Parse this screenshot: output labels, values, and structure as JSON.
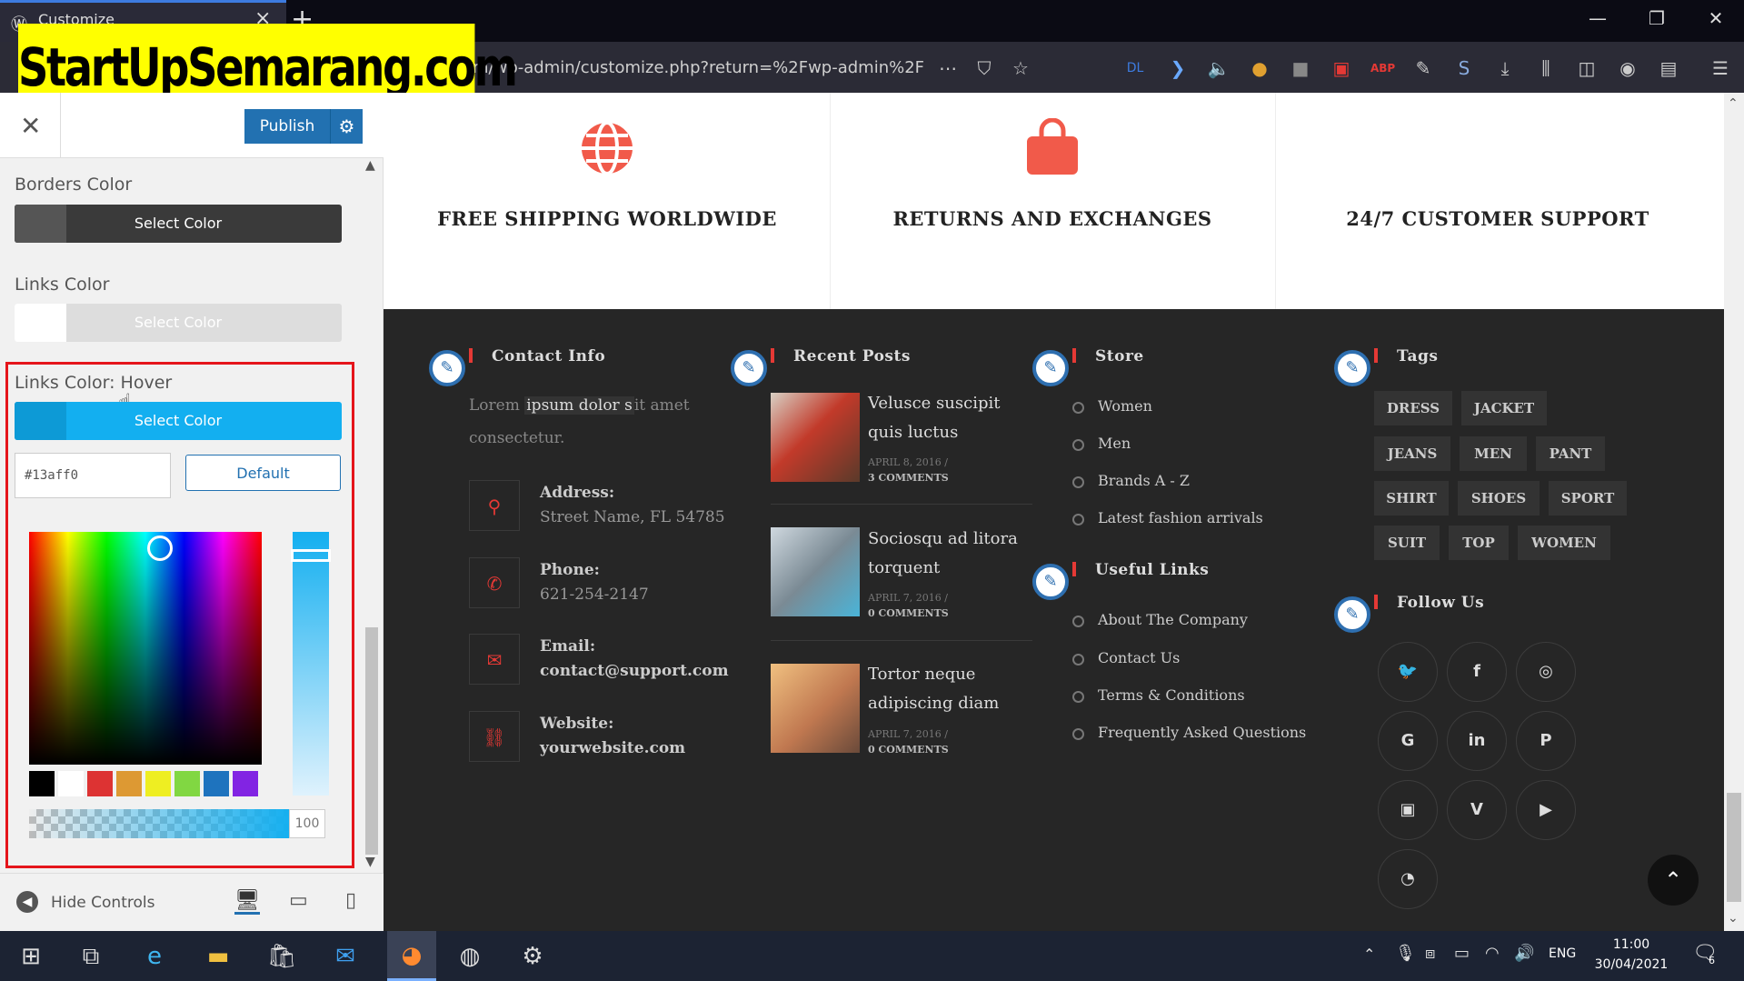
{
  "browser": {
    "tab_title": "Customize",
    "url": "m/wp-admin/customize.php?return=%2Fwp-admin%2F"
  },
  "brand": "StartUpSemarang.com",
  "customizer": {
    "publish_label": "Publish",
    "borders_color_label": "Borders Color",
    "links_color_label": "Links Color",
    "links_hover_label": "Links Color: Hover",
    "select_color_label": "Select Color",
    "hex_value": "#13aff0",
    "default_label": "Default",
    "alpha_value": "100",
    "hide_controls_label": "Hide Controls",
    "colors": {
      "borders": "#3a3a3a",
      "links": "#ffffff",
      "hover": "#13aff0",
      "accent_blue": "#2271b1"
    },
    "palette": [
      "#000000",
      "#ffffff",
      "#dd3333",
      "#dd9933",
      "#eeee22",
      "#81d742",
      "#1e73be",
      "#8224e3"
    ]
  },
  "features": [
    {
      "icon": "globe-icon",
      "title": "FREE SHIPPING WORLDWIDE"
    },
    {
      "icon": "shopping-bag-icon",
      "title": "RETURNS AND EXCHANGES"
    },
    {
      "icon": "support-icon",
      "title": "24/7 CUSTOMER SUPPORT"
    }
  ],
  "footer": {
    "contact": {
      "title": "Contact Info",
      "intro_1": "Lorem ",
      "intro_highlight": "ipsum dolor s",
      "intro_2": "it amet",
      "intro_3": "consectetur.",
      "address_label": "Address:",
      "address": "Street Name, FL 54785",
      "phone_label": "Phone:",
      "phone": "621-254-2147",
      "email_label": "Email:",
      "email": "contact@support.com",
      "website_label": "Website:",
      "website": "yourwebsite.com"
    },
    "posts": {
      "title": "Recent Posts",
      "items": [
        {
          "title1": "Veluscе suscipit",
          "title2": "quis luctus",
          "date": "APRIL 8, 2016 /",
          "comments": "3 COMMENTS"
        },
        {
          "title1": "Sociosqu ad litora",
          "title2": "torquent",
          "date": "APRIL 7, 2016 /",
          "comments": "0 COMMENTS"
        },
        {
          "title1": "Tortor neque",
          "title2": "adipiscing diam",
          "date": "APRIL 7, 2016 /",
          "comments": "0 COMMENTS"
        }
      ]
    },
    "store": {
      "title": "Store",
      "items": [
        "Women",
        "Men",
        "Brands A - Z",
        "Latest fashion arrivals"
      ]
    },
    "useful": {
      "title": "Useful Links",
      "items": [
        "About The Company",
        "Contact Us",
        "Terms & Conditions",
        "Frequently Asked Questions"
      ]
    },
    "tags": {
      "title": "Tags",
      "items": [
        "DRESS",
        "JACKET",
        "JEANS",
        "MEN",
        "PANT",
        "SHIRT",
        "SHOES",
        "SPORT",
        "SUIT",
        "TOP",
        "WOMEN"
      ]
    },
    "follow": {
      "title": "Follow Us"
    }
  },
  "taskbar": {
    "lang": "ENG",
    "time": "11:00",
    "date": "30/04/2021",
    "notifications": "6"
  }
}
